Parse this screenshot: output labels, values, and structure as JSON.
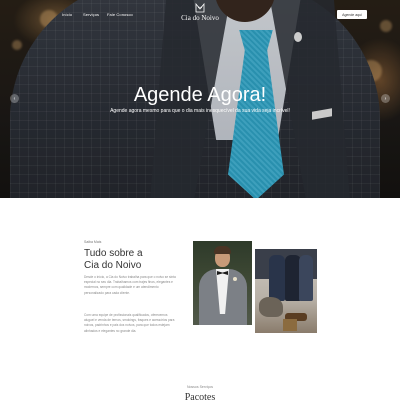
{
  "nav": {
    "links": [
      "Início",
      "Serviços",
      "Fale Conosco"
    ],
    "brand": "Cia do Noivo",
    "brand_icon": "bow-tie-suit-icon",
    "cta_label": "Agende aqui"
  },
  "hero": {
    "title": "Agende Agora!",
    "subtitle": "Agende agora mesmo para que o dia mais inesquecível da sua vida seja incrível!",
    "arrow_left": "‹",
    "arrow_right": "›"
  },
  "about": {
    "eyebrow": "Saiba Mais",
    "title_line1": "Tudo sobre a",
    "title_line2": "Cia do Noivo",
    "paragraph1": "Desde o início, a Cia do Noivo trabalha para que o noivo se sinta especial no seu dia. Trabalhamos com trajes finos, elegantes e modernos, sempre com qualidade e um atendimento personalizado para cada cliente.",
    "paragraph2": "Com uma equipe de profissionais qualificados, oferecemos aluguel e venda de ternos, smokings, fraques e acessórios para noivos, padrinhos e pais dos noivos, para que todos estejam alinhados e elegantes no grande dia."
  },
  "section2": {
    "eyebrow": "Nossos Serviços",
    "title": "Pacotes"
  }
}
